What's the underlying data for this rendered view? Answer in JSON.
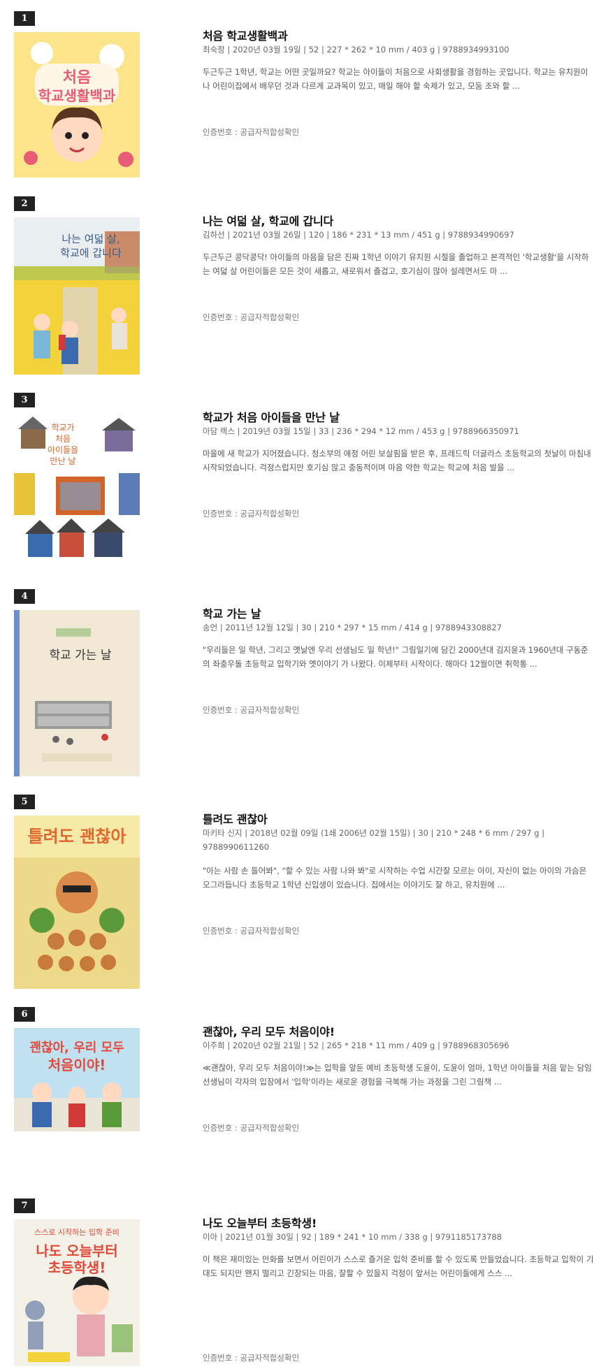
{
  "books": [
    {
      "rank": "1",
      "title": "처음 학교생활백과",
      "meta": "최숙정 | 2020년 03월 19일 | 52 | 227 * 262 * 10 mm / 403 g | 9788934993100",
      "desc": "두근두근 1학년, 학교는 어떤 곳일까요? 학교는 아이들이 처음으로 사회생활을 경험하는 곳입니다. 학교는 유치원이나 어린이집에서 배우던 것과 다르게 교과목이 있고, 매일 해야 할 숙제가 있고, 모둠 조와 할 ...",
      "cert": "인증번호 : 공급자적합성확인",
      "cover_text": "처음 학교생활백과",
      "cover_bg": "#fbe48a",
      "cover_accent": "#e85d75"
    },
    {
      "rank": "2",
      "title": "나는 여덟 살, 학교에 갑니다",
      "meta": "김하선 | 2021년 03월 26일 | 120 | 186 * 231 * 13 mm / 451 g | 9788934990697",
      "desc": "두근두근 콩닥콩닥! 아이들의 마음을 담은 진짜 1학년 이야기 유치원 시절을 졸업하고 본격적인 '학교생활'을 시작하는 여덟 살 어린이들은 모든 것이 새롭고, 새로워서 즐겁고, 호기심이 많아 설레면서도 마 ...",
      "cert": "인증번호 : 공급자적합성확인",
      "cover_text": "나는 여덟 살, 학교에 갑니다",
      "cover_bg": "#f3d23a",
      "cover_accent": "#6bb6d8"
    },
    {
      "rank": "3",
      "title": "학교가 처음 아이들을 만난 날",
      "meta": "아담 렉스 | 2019년 03월 15일 | 33 | 236 * 294 * 12 mm / 453 g | 9788966350971",
      "desc": "마을에 새 학교가 지어졌습니다. 청소부의 애정 어린 보살핌을 받은 후, 프레드릭 더글라스 초등학교의 첫날이 마침내 시작되었습니다. 걱정스럽지만 호기심 많고 충동적이며 마음 약한 학교는 학교에 처음 발을 ...",
      "cert": "인증번호 : 공급자적합성확인",
      "cover_text": "학교가 처음 아이들을 만난 날",
      "cover_bg": "#ffffff",
      "cover_accent": "#d2642a"
    },
    {
      "rank": "4",
      "title": "학교 가는 날",
      "meta": "송언 | 2011년 12월 12일 | 30 | 210 * 297 * 15 mm / 414 g | 9788943308827",
      "desc": "\"우리들은 일 학년, 그리고 옛날엔 우리 선생님도 일 학년!\" 그림일기에 담긴 2000년대 김지윤과 1960년대 구동준의 좌충우돌 초등학교 입학기와 옛이야기 가 나왔다. 이제부터 시작이다. 해마다 12월이면 취학통 ...",
      "cert": "인증번호 : 공급자적합성확인",
      "cover_text": "학교 가는 날",
      "cover_bg": "#f1e8d6",
      "cover_accent": "#6f8fc8"
    },
    {
      "rank": "5",
      "title": "틀려도 괜찮아",
      "meta": "마키타 신지 | 2018년 02월 09일 (1쇄 2006년 02월 15일) | 30 | 210 * 248 * 6 mm / 297 g | 9788990611260",
      "desc": "\"아는 사람 손 들어봐\", \"할 수 있는 사람 나와 봐\"로 시작하는 수업 시간잘 모르는 아이, 자신이 없는 아이의 가슴은 오그라듭니다 초등학교 1학년 신입생이 있습니다. 집에서는 이야기도 잘 하고, 유치원에 ...",
      "cert": "인증번호 : 공급자적합성확인",
      "cover_text": "틀려도 괜찮아",
      "cover_bg": "#f7e9a8",
      "cover_accent": "#e0682c"
    },
    {
      "rank": "6",
      "title": "괜찮아, 우리 모두 처음이야!",
      "meta": "이주희 | 2020년 02월 21일 | 52 | 265 * 218 * 11 mm / 409 g | 9788968305696",
      "desc": "≪괜찮아, 우리 모두 처음이야!≫는 입학을 앞둔 예비 초등학생 도윤이, 도윤이 엄마, 1학년 아이들을 처음 맡는 담임 선생님이 각자의 입장에서 '입학'이라는 새로운 경험을 극복해 가는 과정을 그린 그림책 ...",
      "cert": "인증번호 : 공급자적합성확인",
      "cover_text": "괜찮아, 우리 모두 처음이야!",
      "cover_bg": "#bfe1f0",
      "cover_accent": "#e64a3c"
    },
    {
      "rank": "7",
      "title": "나도 오늘부터 초등학생!",
      "meta": "이아 | 2021년 01월 30일 | 92 | 189 * 241 * 10 mm / 338 g | 9791185173788",
      "desc": "이 책은 재미있는 만화를 보면서 어린이가 스스로 즐거운 입학 준비를 할 수 있도록 만들었습니다. 초등학교 입학이 기대도 되지만 왠지 떨리고 긴장되는 마음, 잘할 수 있을지 걱정이 앞서는 어린이들에게 스스 ...",
      "cert": "인증번호 : 공급자적합성확인",
      "cover_text": "나도 오늘부터 초등학생!",
      "cover_bg": "#f4f1e8",
      "cover_accent": "#e04a3a"
    }
  ]
}
